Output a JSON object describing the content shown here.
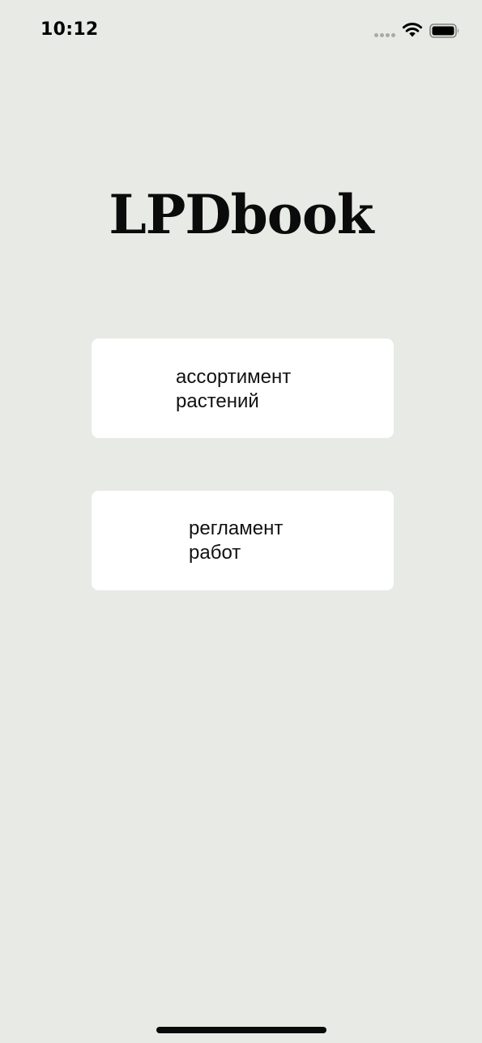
{
  "status_bar": {
    "time": "10:12",
    "icons": [
      "cellular-signal-icon",
      "wifi-icon",
      "battery-icon"
    ]
  },
  "app": {
    "title": "LPDbook"
  },
  "menu": [
    {
      "line1": "ассортимент",
      "line2": "растений"
    },
    {
      "line1": "регламент",
      "line2": "работ"
    }
  ],
  "colors": {
    "background": "#e8ebe5",
    "card": "#ffffff",
    "text": "#111111",
    "signal_inactive": "#a9aaa7"
  }
}
